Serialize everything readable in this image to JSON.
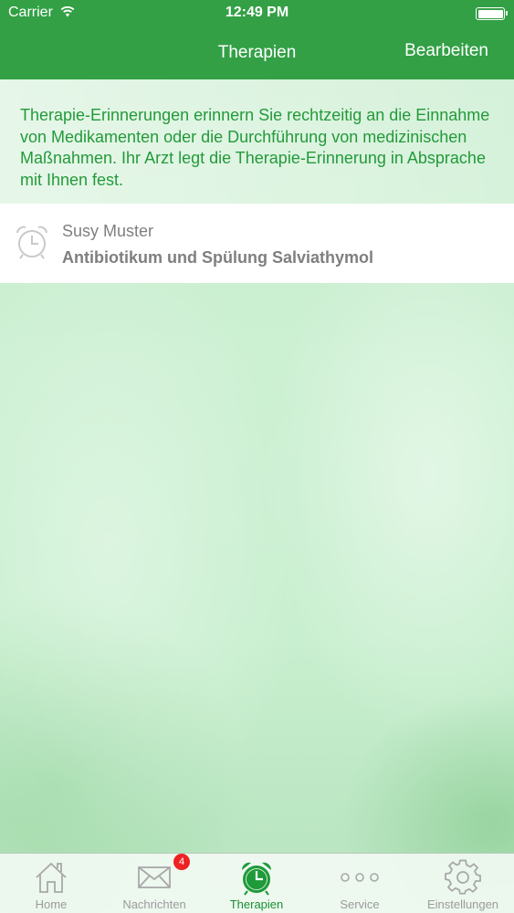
{
  "status_bar": {
    "carrier": "Carrier",
    "time": "12:49 PM"
  },
  "nav": {
    "title": "Therapien",
    "edit_label": "Bearbeiten"
  },
  "info": {
    "text": "Therapie-Erinnerungen erinnern Sie rechtzeitig an die Einnahme von Medikamenten oder die Durchführung von medizinischen Maßnahmen. Ihr Arzt legt die Therapie-Erinnerung in Absprache mit Ihnen fest."
  },
  "reminders": [
    {
      "patient": "Susy Muster",
      "therapy": "Antibiotikum und Spülung Salviathymol",
      "icon": "alarm-clock-icon"
    }
  ],
  "tabbar": {
    "tabs": [
      {
        "label": "Home",
        "icon": "home-icon",
        "active": false
      },
      {
        "label": "Nachrichten",
        "icon": "envelope-icon",
        "active": false,
        "badge": "4"
      },
      {
        "label": "Therapien",
        "icon": "alarm-clock-icon",
        "active": true
      },
      {
        "label": "Service",
        "icon": "more-dots-icon",
        "active": false
      },
      {
        "label": "Einstellungen",
        "icon": "gear-icon",
        "active": false
      }
    ]
  },
  "colors": {
    "accent": "#33a046",
    "info_text": "#239a3a",
    "active_tab": "#1a8f33",
    "badge": "#ee2222"
  }
}
